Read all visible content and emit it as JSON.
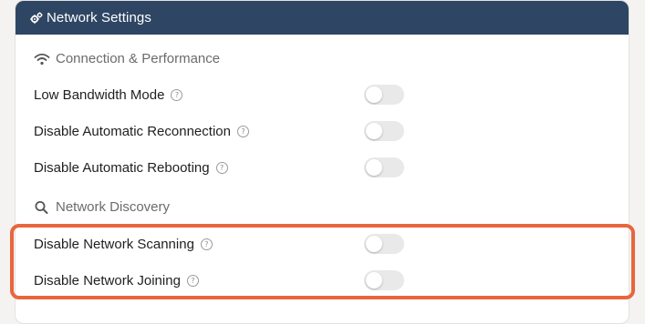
{
  "panel": {
    "title": "Network Settings",
    "icon": "gears-icon",
    "header_color": "#2e4663"
  },
  "sections": [
    {
      "title": "Connection & Performance",
      "icon": "wifi-icon",
      "items": [
        {
          "label": "Low Bandwidth Mode",
          "help_icon": "help-circle-icon",
          "enabled": false
        },
        {
          "label": "Disable Automatic Reconnection",
          "help_icon": "help-circle-icon",
          "enabled": false
        },
        {
          "label": "Disable Automatic Rebooting",
          "help_icon": "help-circle-icon",
          "enabled": false
        }
      ]
    },
    {
      "title": "Network Discovery",
      "icon": "search-icon",
      "items": [
        {
          "label": "Disable Network Scanning",
          "help_icon": "help-circle-icon",
          "enabled": false
        },
        {
          "label": "Disable Network Joining",
          "help_icon": "help-circle-icon",
          "enabled": false
        }
      ]
    }
  ],
  "help_glyph": "?",
  "highlight_color": "#e8663d"
}
